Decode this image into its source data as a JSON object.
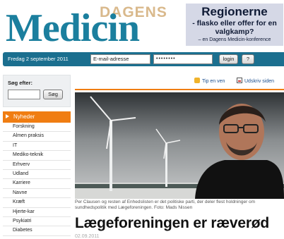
{
  "masthead": {
    "logo_top": "DAGENS",
    "logo_main": "Medicin",
    "banner_title": "Regionerne",
    "banner_line1": "- flasko eller offer for en",
    "banner_line2": "valgkamp?",
    "banner_foot": "– en Dagens Medicin-konference"
  },
  "loginbar": {
    "date": "Fredag 2 september 2011",
    "email_placeholder": "E-mail-adresse",
    "password_value": "••••••••",
    "login_label": "login",
    "help_label": "?"
  },
  "search": {
    "label": "Søg efter:",
    "button": "Søg"
  },
  "nav": {
    "active": "Nyheder",
    "items": [
      "Forskning",
      "Almen praksis",
      "IT",
      "Mediko-teknik",
      "Erhverv",
      "Udland",
      "Karriere",
      "Navne",
      "Kræft",
      "Hjerte-kar",
      "Psykiatri",
      "Diabetes"
    ]
  },
  "tools": {
    "tip": "Tip en ven",
    "print": "Udskriv siden"
  },
  "article": {
    "caption": "Per Clausen og resten af Enhedslisten er det politiske parti, der deler flest holdninger om sundhedspolitik med Lægeforeningen. Foto: Mads Nissen",
    "headline": "Lægeforeningen er ræverød",
    "date": "02.09.2011"
  },
  "colors": {
    "brand_blue": "#1b7f9e",
    "bar_blue": "#1b6f8f",
    "accent_orange": "#f07d12",
    "logo_tan": "#d9b98c"
  }
}
